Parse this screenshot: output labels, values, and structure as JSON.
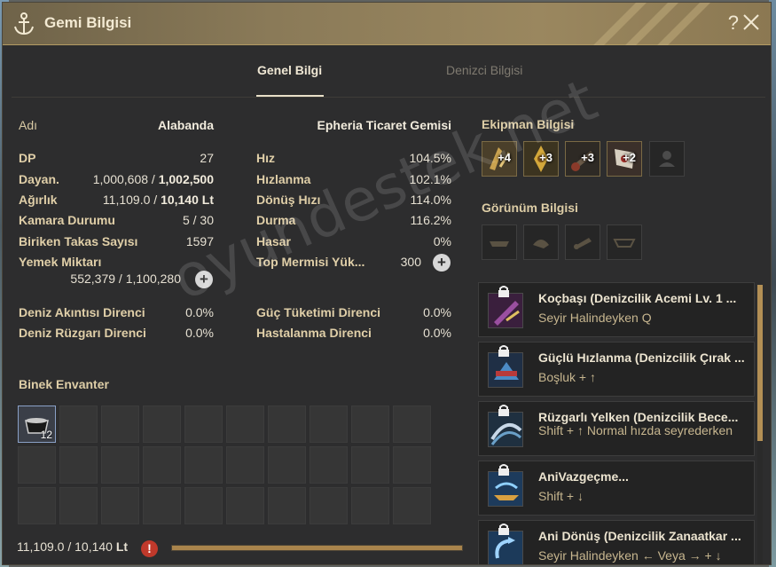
{
  "window": {
    "title": "Gemi Bilgisi",
    "help": "?"
  },
  "tabs": [
    {
      "label": "Genel Bilgi",
      "active": true
    },
    {
      "label": "Denizci Bilgisi",
      "active": false
    }
  ],
  "ship": {
    "name_label": "Adı",
    "name_value": "Alabanda",
    "type": "Epheria Ticaret Gemisi"
  },
  "stats_left": [
    {
      "label": "DP",
      "value": "27"
    },
    {
      "label": "Dayan.",
      "value_a": "1,000,608",
      "value_b": "1,002,500"
    },
    {
      "label": "Ağırlık",
      "value_a": "11,109.0",
      "value_b": "10,140",
      "unit": "Lt"
    },
    {
      "label": "Kamara Durumu",
      "value_a": "5",
      "value_b": "30"
    },
    {
      "label": "Biriken Takas Sayısı",
      "value": "1597"
    },
    {
      "label": "Yemek Miktarı",
      "value_a": "552,379",
      "value_b": "1,100,280"
    }
  ],
  "stats_right": [
    {
      "label": "Hız",
      "value": "104.5%"
    },
    {
      "label": "Hızlanma",
      "value": "102.1%"
    },
    {
      "label": "Dönüş Hızı",
      "value": "114.0%"
    },
    {
      "label": "Durma",
      "value": "116.2%"
    },
    {
      "label": "Hasar",
      "value": "0%"
    },
    {
      "label": "Top Mermisi Yük...",
      "value": "300"
    }
  ],
  "resist_left": [
    {
      "label": "Deniz Akıntısı Direnci",
      "value": "0.0%"
    },
    {
      "label": "Deniz Rüzgarı Direnci",
      "value": "0.0%"
    }
  ],
  "resist_right": [
    {
      "label": "Güç Tüketimi Direnci",
      "value": "0.0%"
    },
    {
      "label": "Hastalanma Direnci",
      "value": "0.0%"
    }
  ],
  "equipment": {
    "title": "Ekipman Bilgisi",
    "slots": [
      {
        "icon": "prow-icon",
        "badge": "+4"
      },
      {
        "icon": "figurehead-icon",
        "badge": "+3"
      },
      {
        "icon": "cannon-icon",
        "badge": "+3"
      },
      {
        "icon": "sail-icon",
        "badge": "+2"
      },
      {
        "icon": "sailor-icon",
        "badge": ""
      }
    ]
  },
  "appearance": {
    "title": "Görünüm Bilgisi",
    "slots": [
      "hull-deco-icon",
      "prow-deco-icon",
      "cannon-deco-icon",
      "flag-deco-icon"
    ]
  },
  "inventory": {
    "title": "Binek Envanter",
    "first_item_icon": "cargo-icon",
    "first_item_count": "12",
    "weight_a": "11,109.0",
    "weight_b": "10,140",
    "weight_unit": "Lt",
    "weight_fill_fraction": 1.0,
    "warning_icon": "!"
  },
  "skills": [
    {
      "name": "Koçbaşı (Denizcilik Acemi Lv. 1 ...",
      "key": "Seyir Halindeyken Q",
      "color": "#7a3c7e"
    },
    {
      "name": "Güçlü Hızlanma (Denizcilik Çırak ...",
      "key": "Boşluk + ↑",
      "color": "#2c5f8a"
    },
    {
      "name": "Rüzgarlı Yelken (Denizcilik Bece...",
      "key": "Shift + ↑ Normal hızda seyrederken",
      "color": "#3d6a8a"
    },
    {
      "name": "AniVazgeçme...",
      "key": "Shift + ↓",
      "color": "#3476b0"
    },
    {
      "name": "Ani Dönüş (Denizcilik Zanaatkar ...",
      "key": "Seyir Halindeyken ← Veya → + ↓",
      "color": "#2f6aa5"
    }
  ],
  "watermark": "oyundestek.net"
}
